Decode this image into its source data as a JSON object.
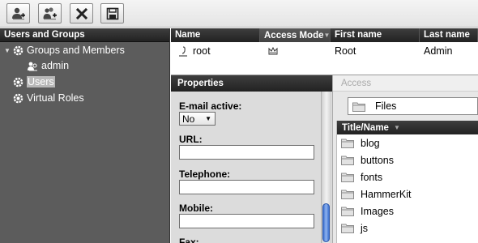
{
  "toolbar": {
    "buttons": [
      {
        "name": "add-user",
        "icon": "add-user-icon"
      },
      {
        "name": "add-group",
        "icon": "add-group-icon"
      },
      {
        "name": "delete",
        "icon": "close-icon"
      },
      {
        "name": "save",
        "icon": "save-icon"
      }
    ]
  },
  "sidebar": {
    "title": "Users and Groups",
    "items": [
      {
        "label": "Groups and Members",
        "icon": "gear-icon",
        "expanded": true
      },
      {
        "label": "admin",
        "icon": "group-user-icon"
      },
      {
        "label": "Users",
        "icon": "gear-icon",
        "selected": true
      },
      {
        "label": "Virtual Roles",
        "icon": "gear-icon"
      }
    ]
  },
  "members": {
    "columns": [
      "Name",
      "Access Mode",
      "First name",
      "Last name"
    ],
    "sorted_column": "Access Mode",
    "rows": [
      {
        "name": "root",
        "access_icon": "crown-icon",
        "first": "Root",
        "last": "Admin"
      }
    ]
  },
  "properties": {
    "title": "Properties",
    "email_active_label": "E-mail active:",
    "email_active_value": "No",
    "url_label": "URL:",
    "telephone_label": "Telephone:",
    "mobile_label": "Mobile:",
    "fax_label": "Fax:"
  },
  "access": {
    "title": "Access",
    "folder": "Files",
    "list_header": "Title/Name",
    "items": [
      "blog",
      "buttons",
      "fonts",
      "HammerKit",
      "Images",
      "js"
    ]
  },
  "colors": {
    "header_dark": "#222222",
    "sidebar_bg": "#5c5c5c",
    "selection": "#b8b8b8",
    "scroll_thumb": "#3b6fcf"
  }
}
